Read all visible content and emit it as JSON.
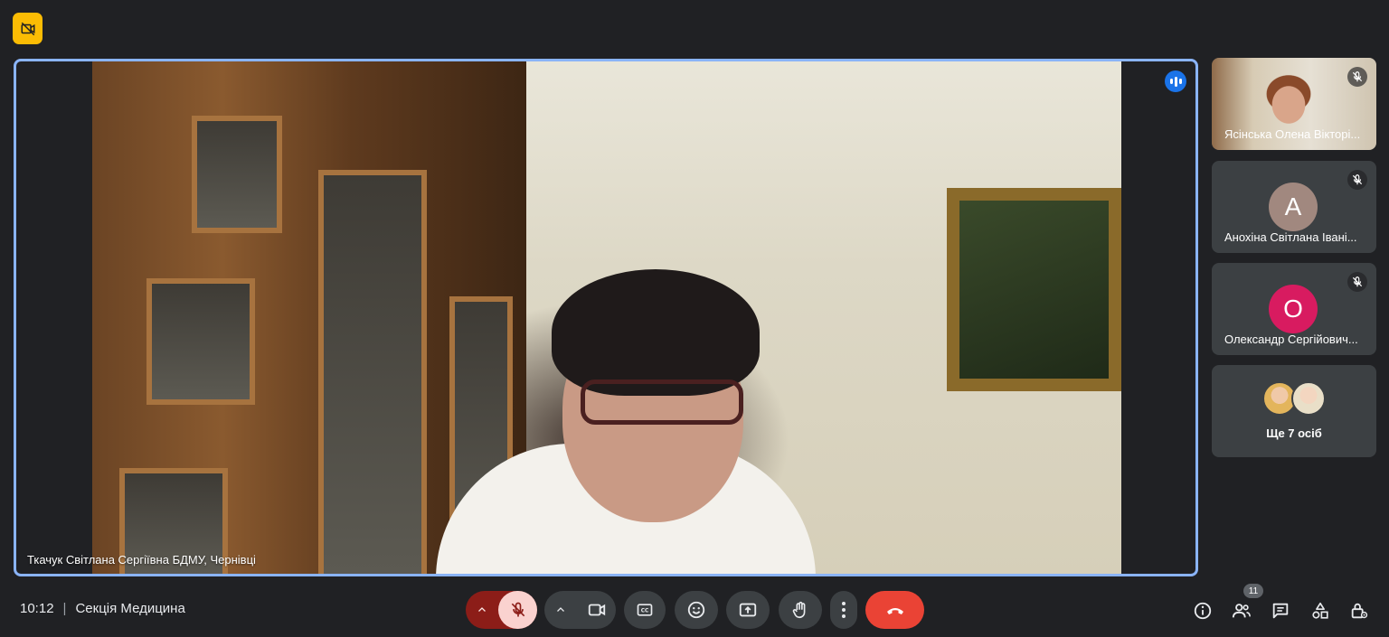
{
  "main_tile": {
    "speaker_name": "Ткачук Світлана Сергіївна БДМУ, Чернівці"
  },
  "participants": [
    {
      "name": "Ясінська Олена Вікторі...",
      "type": "video"
    },
    {
      "name": "Анохіна Світлана Івані...",
      "type": "avatar",
      "initial": "А",
      "color": "#a1887f"
    },
    {
      "name": "Олександр Сергійович...",
      "type": "avatar",
      "initial": "О",
      "color": "#d81b60"
    }
  ],
  "more_participants": {
    "label": "Ще 7 осіб"
  },
  "meeting": {
    "time": "10:12",
    "separator": "|",
    "title": "Секція Медицина"
  },
  "people_count": "11",
  "colors": {
    "background": "#202124",
    "tile": "#3c4043",
    "active_border": "#8ab4f8",
    "end_call": "#ea4335",
    "mic_muted": "#fad2cf",
    "mic_caret": "#8c1d18",
    "recording_badge": "#fbbc04"
  },
  "icons": {
    "recording": "camera-off-icon",
    "mic": "mic-off-icon",
    "camera": "videocam-icon",
    "captions": "closed-caption-icon",
    "emoji": "emoji-icon",
    "present": "present-screen-icon",
    "hand": "raise-hand-icon",
    "more": "more-vert-icon",
    "end_call": "call-end-icon",
    "info": "info-icon",
    "people": "people-icon",
    "chat": "chat-icon",
    "activities": "activities-icon",
    "host_controls": "host-controls-lock-icon"
  }
}
